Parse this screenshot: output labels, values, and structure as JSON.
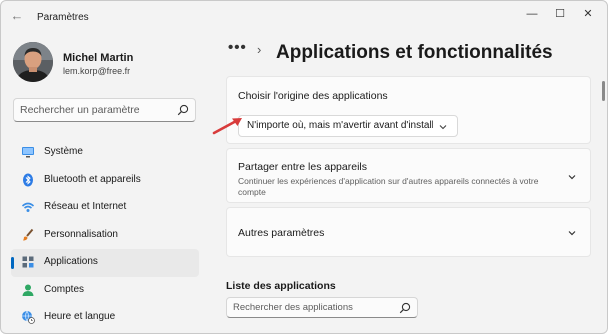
{
  "window": {
    "title": "Paramètres",
    "controls": {
      "minimize": "—",
      "maximize": "☐",
      "close": "✕"
    },
    "back_glyph": "←"
  },
  "user": {
    "name": "Michel Martin",
    "email": "lem.korp@free.fr"
  },
  "sidebar": {
    "search_placeholder": "Rechercher un paramètre",
    "items": [
      {
        "label": "Système",
        "icon": "monitor-icon",
        "active": false
      },
      {
        "label": "Bluetooth et appareils",
        "icon": "bluetooth-icon",
        "active": false
      },
      {
        "label": "Réseau et Internet",
        "icon": "wifi-icon",
        "active": false
      },
      {
        "label": "Personnalisation",
        "icon": "brush-icon",
        "active": false
      },
      {
        "label": "Applications",
        "icon": "apps-icon",
        "active": true
      },
      {
        "label": "Comptes",
        "icon": "account-icon",
        "active": false
      },
      {
        "label": "Heure et langue",
        "icon": "globe-clock-icon",
        "active": false
      }
    ]
  },
  "breadcrumb": {
    "ellipsis": "•••",
    "separator": "›",
    "title": "Applications et fonctionnalités"
  },
  "cards": {
    "origin": {
      "title": "Choisir l'origine des applications",
      "dropdown_value": "N'importe où, mais m'avertir avant d'installer une application"
    },
    "share": {
      "title": "Partager entre les appareils",
      "description": "Continuer les expériences d'application sur d'autres appareils connectés à votre compte"
    },
    "more": {
      "title": "Autres paramètres"
    }
  },
  "apps_list": {
    "title": "Liste des applications",
    "search_placeholder": "Rechercher des applications"
  },
  "colors": {
    "accent": "#0067c0",
    "annotation_arrow": "#d83b3b",
    "window_bg": "#f3f3f3",
    "card_bg": "#fbfbfb"
  }
}
